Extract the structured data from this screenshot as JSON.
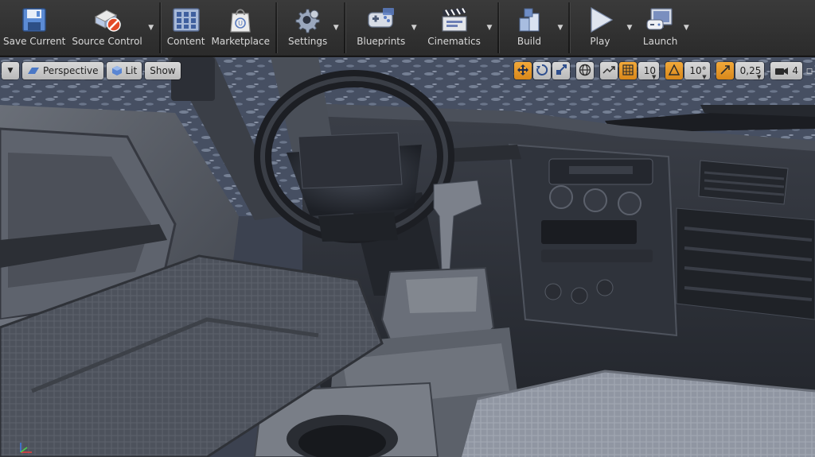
{
  "toolbar": {
    "save_current": "Save Current",
    "source_control": "Source Control",
    "content": "Content",
    "marketplace": "Marketplace",
    "settings": "Settings",
    "blueprints": "Blueprints",
    "cinematics": "Cinematics",
    "build": "Build",
    "play": "Play",
    "launch": "Launch"
  },
  "viewport": {
    "view_mode": "Perspective",
    "lighting_mode": "Lit",
    "show_label": "Show",
    "grid_snap_value": "10",
    "rotation_snap_value": "10°",
    "scale_snap_value": "0,25",
    "camera_speed_value": "4"
  },
  "colors": {
    "snap_active": "#e89a2a",
    "toolbar_bg": "#2f2f2f",
    "viewport_button": "#c8c8c8"
  }
}
